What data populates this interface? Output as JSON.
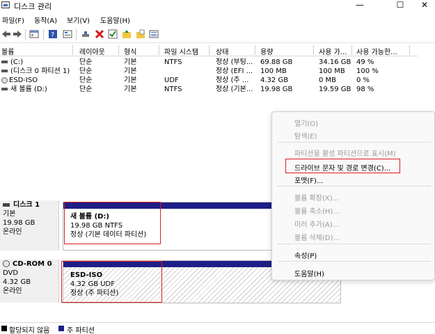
{
  "window": {
    "title": "디스크 관리",
    "controls": [
      "—",
      "☐",
      "✕"
    ]
  },
  "menu": [
    "파일(F)",
    "동작(A)",
    "보기(V)",
    "도움말(H)"
  ],
  "toolbar": [
    "back-arrow-icon",
    "forward-arrow-icon",
    "panel-icon",
    "help-icon",
    "properties-icon",
    "connect-icon",
    "delete-icon",
    "check-icon",
    "up-folder-icon",
    "open-folder-icon",
    "list-icon"
  ],
  "table": {
    "headers": [
      "볼륨",
      "레이아웃",
      "형식",
      "파일 시스템",
      "상태",
      "용량",
      "사용 가...",
      "사용 가능한..."
    ],
    "rows": [
      [
        "(C:)",
        "단순",
        "기본",
        "NTFS",
        "정상 (부팅...",
        "69.88 GB",
        "34.16 GB",
        "49 %"
      ],
      [
        "(디스크 0 파티션 1)",
        "단순",
        "기본",
        "",
        "정상 (EFI ...",
        "100 MB",
        "100 MB",
        "100 %"
      ],
      [
        "ESD-ISO",
        "단순",
        "기본",
        "UDF",
        "정상 (주 ...",
        "4.32 GB",
        "0 MB",
        "0 %"
      ],
      [
        "새 볼륨 (D:)",
        "단순",
        "기본",
        "NTFS",
        "정상 (기본...",
        "19.98 GB",
        "19.59 GB",
        "98 %"
      ]
    ]
  },
  "disks": [
    {
      "name": "디스크 1",
      "type": "기본",
      "size": "19.98 GB",
      "status": "온라인",
      "partition": {
        "name": "새 볼륨  (D:)",
        "detail": "19.98 GB NTFS",
        "status": "정상 (기본 데이터 파티션)"
      }
    },
    {
      "name": "CD-ROM 0",
      "type": "DVD",
      "size": "4.32 GB",
      "status": "온라인",
      "partition": {
        "name": "ESD-ISO",
        "detail": "4.32 GB UDF",
        "status": "정상 (주 파티션)"
      }
    }
  ],
  "legend": [
    {
      "label": "할당되지 않음",
      "color": "#000000"
    },
    {
      "label": "주 파티션",
      "color": "#1e1e87"
    }
  ],
  "context_menu": [
    {
      "label": "열기(O)",
      "enabled": false
    },
    {
      "label": "탐색(E)",
      "enabled": false
    },
    {
      "label": "파티션을 활성 파티션으로 표시(M)",
      "enabled": false
    },
    {
      "label": "드라이브 문자 및 경로 변경(C)...",
      "enabled": true
    },
    {
      "label": "포맷(F)...",
      "enabled": true
    },
    {
      "label": "볼륨 확장(X)...",
      "enabled": false
    },
    {
      "label": "볼륨 축소(H)...",
      "enabled": false
    },
    {
      "label": "미러 추가(A)...",
      "enabled": false
    },
    {
      "label": "볼륨 삭제(D)...",
      "enabled": false
    },
    {
      "label": "속성(P)",
      "enabled": true
    },
    {
      "label": "도움말(H)",
      "enabled": true
    }
  ],
  "colors": {
    "primary_partition": "#1e1e87",
    "highlight": "#e01b1b"
  }
}
